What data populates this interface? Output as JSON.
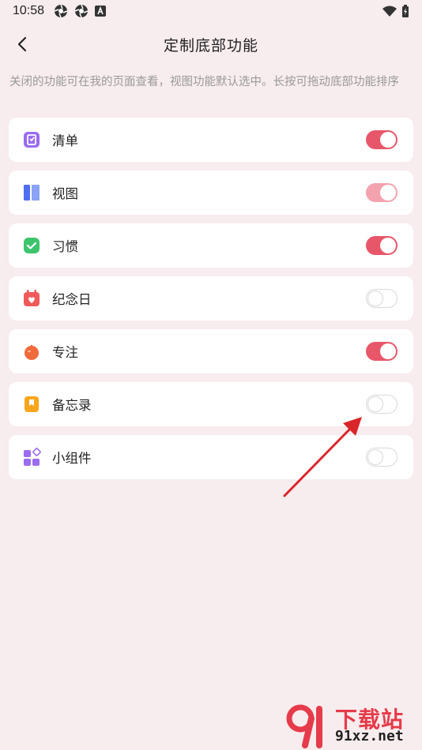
{
  "status_bar": {
    "time": "10:58"
  },
  "header": {
    "title": "定制底部功能"
  },
  "description": "关闭的功能可在我的页面查看，视图功能默认选中。长按可拖动底部功能排序",
  "items": [
    {
      "label": "清单",
      "icon": "checklist-icon",
      "icon_color": "#9b6cf0",
      "enabled": true
    },
    {
      "label": "视图",
      "icon": "view-icon",
      "icon_color": "#5b7cf0",
      "enabled": true,
      "locked": true
    },
    {
      "label": "习惯",
      "icon": "habit-icon",
      "icon_color": "#3ec46d",
      "enabled": true
    },
    {
      "label": "纪念日",
      "icon": "calendar-heart-icon",
      "icon_color": "#f05a5a",
      "enabled": false
    },
    {
      "label": "专注",
      "icon": "tomato-icon",
      "icon_color": "#f06a3c",
      "enabled": true
    },
    {
      "label": "备忘录",
      "icon": "memo-icon",
      "icon_color": "#f7a51c",
      "enabled": false
    },
    {
      "label": "小组件",
      "icon": "widgets-icon",
      "icon_color": "#9b6cf0",
      "enabled": false
    }
  ],
  "colors": {
    "accent": "#e8566a",
    "background": "#f7ecee"
  },
  "watermark": {
    "brand": "下载站",
    "domain": "91xz.net"
  }
}
